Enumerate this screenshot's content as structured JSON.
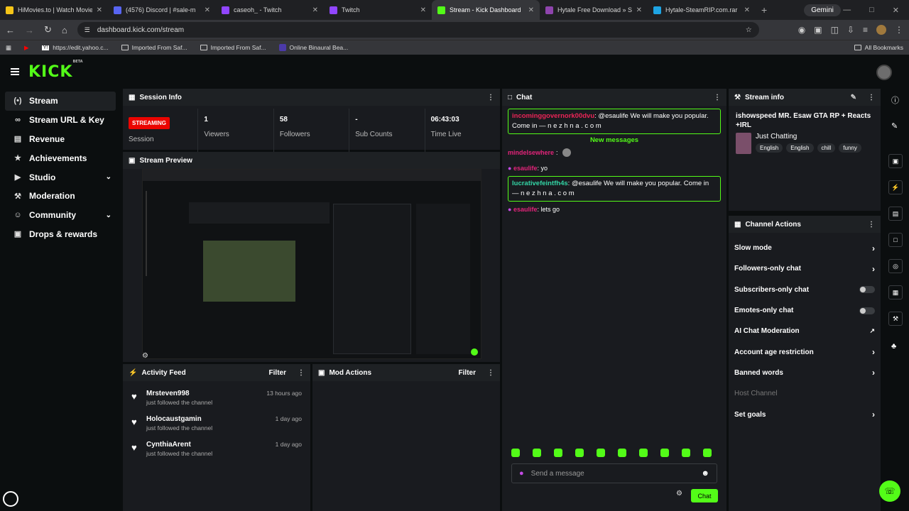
{
  "browser": {
    "tabs": [
      {
        "title": "HiMovies.to | Watch Movies O",
        "color": "#f5c518"
      },
      {
        "title": "(4576) Discord | #​​sale-m",
        "color": "#5865f2"
      },
      {
        "title": "caseoh_ - Twitch",
        "color": "#9146ff"
      },
      {
        "title": "Twitch",
        "color": "#9146ff"
      },
      {
        "title": "Stream - Kick Dashboard",
        "color": "#53fc18"
      },
      {
        "title": "Hytale Free Download » Stea",
        "color": "#8e44ad"
      },
      {
        "title": "Hytale-SteamRIP.com.rar",
        "color": "#1ea4e3"
      }
    ],
    "gemini_label": "Gemini",
    "url": "dashboard.kick.com/stream",
    "bookmarks": [
      "https://edit.yahoo.c...",
      "Imported From Saf...",
      "Imported From Saf...",
      "Online Binaural Bea..."
    ],
    "all_bookmarks": "All Bookmarks"
  },
  "logo": {
    "text": "KICK",
    "badge": "BETA"
  },
  "sidebar": {
    "items": [
      {
        "label": "Stream",
        "icon": "stream-icon",
        "glyph": "(•)",
        "active": true
      },
      {
        "label": "Stream URL & Key",
        "icon": "link-icon",
        "glyph": "∞"
      },
      {
        "label": "Revenue",
        "icon": "revenue-icon",
        "glyph": "▤"
      },
      {
        "label": "Achievements",
        "icon": "trophy-icon",
        "glyph": "★"
      },
      {
        "label": "Studio",
        "icon": "studio-icon",
        "glyph": "▶",
        "chevron": true
      },
      {
        "label": "Moderation",
        "icon": "wrench-icon",
        "glyph": "⚒"
      },
      {
        "label": "Community",
        "icon": "community-icon",
        "glyph": "☺",
        "chevron": true
      },
      {
        "label": "Drops & rewards",
        "icon": "drops-icon",
        "glyph": "▣"
      }
    ]
  },
  "session": {
    "title": "Session Info",
    "status": "STREAMING",
    "status_label": "Session",
    "stats": [
      {
        "value": "1",
        "label": "Viewers"
      },
      {
        "value": "58",
        "label": "Followers"
      },
      {
        "value": "-",
        "label": "Sub Counts"
      },
      {
        "value": "06:43:03",
        "label": "Time Live"
      }
    ]
  },
  "preview": {
    "title": "Stream Preview"
  },
  "activity": {
    "title": "Activity Feed",
    "filter": "Filter",
    "items": [
      {
        "name": "Mrsteven998",
        "sub": "just followed the channel",
        "time": "13 hours ago"
      },
      {
        "name": "Holocaustgamin",
        "sub": "just followed the channel",
        "time": "1 day ago"
      },
      {
        "name": "CynthiaArent",
        "sub": "just followed the channel",
        "time": "1 day ago"
      }
    ]
  },
  "mod": {
    "title": "Mod Actions",
    "filter": "Filter"
  },
  "chat": {
    "title": "Chat",
    "pinned": {
      "user": "incominggovernork00dvu",
      "text": ": @esaulife We will make you popular. Come in — n e z h n a . c o m"
    },
    "new_messages": "New messages",
    "messages": [
      {
        "user": "mindelsewhere",
        "text": ":"
      },
      {
        "user": "esaulife",
        "text": ": yo"
      }
    ],
    "highlight": {
      "user": "lucrativefeintfh4s",
      "text": ": @esaulife We will make you popular. Come in — n e z h n a . c o m"
    },
    "last": {
      "user": "esaulife",
      "text": ": lets go"
    },
    "placeholder": "Send a message",
    "send": "Chat"
  },
  "stream_info": {
    "title": "Stream info",
    "stream_title": "ishowspeed MR. Esaw GTA RP + Reacts +IRL",
    "category": "Just Chatting",
    "tags": [
      "English",
      "English",
      "chill",
      "funny"
    ]
  },
  "channel_actions": {
    "title": "Channel Actions",
    "items": [
      {
        "label": "Slow mode",
        "kind": "arrow"
      },
      {
        "label": "Followers-only chat",
        "kind": "arrow"
      },
      {
        "label": "Subscribers-only chat",
        "kind": "toggle"
      },
      {
        "label": "Emotes-only chat",
        "kind": "toggle"
      },
      {
        "label": "AI Chat Moderation",
        "kind": "ext"
      },
      {
        "label": "Account age restriction",
        "kind": "arrow"
      },
      {
        "label": "Banned words",
        "kind": "arrow"
      },
      {
        "label": "Host Channel",
        "kind": "disabled"
      },
      {
        "label": "Set goals",
        "kind": "arrow"
      }
    ]
  }
}
